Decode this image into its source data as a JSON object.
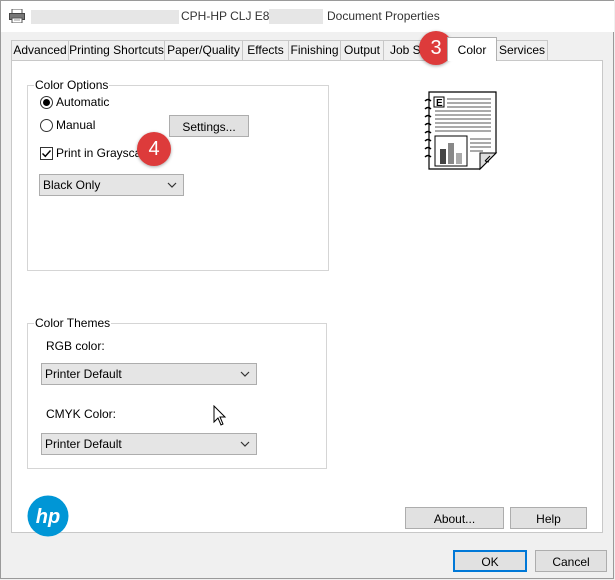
{
  "window": {
    "title": "CPH-HP CLJ E87650-",
    "title_suffix": "Document Properties"
  },
  "tabs": [
    {
      "label": "Advanced"
    },
    {
      "label": "Printing Shortcuts"
    },
    {
      "label": "Paper/Quality"
    },
    {
      "label": "Effects"
    },
    {
      "label": "Finishing"
    },
    {
      "label": "Output"
    },
    {
      "label": "Job St"
    },
    {
      "label": "Color"
    },
    {
      "label": "Services"
    }
  ],
  "active_tab": "Color",
  "color_options": {
    "legend": "Color Options",
    "automatic_label": "Automatic",
    "manual_label": "Manual",
    "selected_mode": "Automatic",
    "settings_button": "Settings...",
    "grayscale_label": "Print in Grayscale",
    "grayscale_checked": true,
    "grayscale_select_value": "Black Only"
  },
  "color_themes": {
    "legend": "Color Themes",
    "rgb_label": "RGB color:",
    "rgb_value": "Printer Default",
    "cmyk_label": "CMYK Color:",
    "cmyk_value": "Printer Default"
  },
  "preview_icon": "document-preview-icon",
  "brand": {
    "logo_text": "hp",
    "color": "#0096d6"
  },
  "buttons": {
    "about": "About...",
    "help": "Help",
    "ok": "OK",
    "cancel": "Cancel"
  },
  "annotations": {
    "step_tab": "3",
    "step_checkbox": "4",
    "badge_color": "#dd3b3b"
  }
}
